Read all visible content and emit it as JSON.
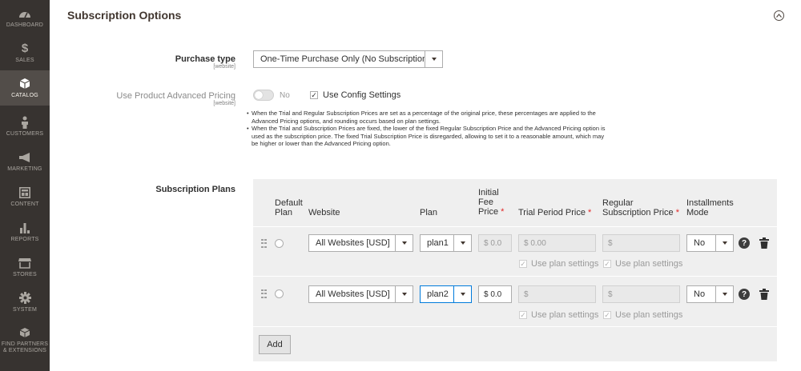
{
  "sidebar": {
    "items": [
      {
        "label": "DASHBOARD",
        "icon": "dashboard-icon"
      },
      {
        "label": "SALES",
        "icon": "dollar-icon"
      },
      {
        "label": "CATALOG",
        "icon": "cube-icon",
        "active": true
      },
      {
        "label": "CUSTOMERS",
        "icon": "person-icon"
      },
      {
        "label": "MARKETING",
        "icon": "megaphone-icon"
      },
      {
        "label": "CONTENT",
        "icon": "layout-icon"
      },
      {
        "label": "REPORTS",
        "icon": "bar-chart-icon"
      },
      {
        "label": "STORES",
        "icon": "storefront-icon"
      },
      {
        "label": "SYSTEM",
        "icon": "gear-icon"
      },
      {
        "label": "FIND PARTNERS & EXTENSIONS",
        "icon": "cubes-icon"
      }
    ],
    "dollar_glyph": "$"
  },
  "section": {
    "title": "Subscription Options"
  },
  "purchase_type": {
    "label": "Purchase type",
    "scope": "[website]",
    "value": "One-Time Purchase Only (No Subscription)"
  },
  "advanced_pricing": {
    "label": "Use Product Advanced Pricing",
    "scope": "[website]",
    "toggle_text": "No",
    "config_label": "Use Config Settings",
    "notes": [
      "When the Trial and Regular Subscription Prices are set as a percentage of the original price, these percentages are applied to the Advanced Pricing options, and rounding occurs based on plan settings.",
      "When the Trial and Subscription Prices are fixed, the lower of the fixed Regular Subscription Price and the Advanced Pricing option is used as the subscription price. The fixed Trial Subscription Price is disregarded, allowing to set it to a reasonable amount, which may be higher or lower than the Advanced Pricing option."
    ]
  },
  "plans": {
    "label": "Subscription Plans",
    "headers": {
      "default_plan_1": "Default",
      "default_plan_2": "Plan",
      "website": "Website",
      "plan": "Plan",
      "initial_fee_1": "Initial",
      "initial_fee_2": "Fee",
      "initial_fee_3": "Price",
      "trial_period": "Trial Period Price",
      "regular_1": "Regular",
      "regular_2": "Subscription Price",
      "installments_1": "Installments",
      "installments_2": "Mode",
      "required_mark": "*"
    },
    "rows": [
      {
        "website": "All Websites [USD]",
        "plan": "plan1",
        "initial_fee": "$  0.0",
        "trial_price": "$  0.00",
        "regular_price": "$",
        "installments": "No",
        "use_plan_label": "Use plan settings"
      },
      {
        "website": "All Websites [USD]",
        "plan": "plan2",
        "initial_fee": "$  0.0",
        "trial_price": "$",
        "regular_price": "$",
        "installments": "No",
        "use_plan_label": "Use plan settings"
      }
    ],
    "add_label": "Add",
    "help_glyph": "?",
    "check_glyph": "✓"
  },
  "colors": {
    "sidebar_bg": "#373330",
    "sidebar_active": "#524d49",
    "table_bg": "#efefef",
    "required": "#e22626",
    "focus_border": "#007bdb"
  }
}
